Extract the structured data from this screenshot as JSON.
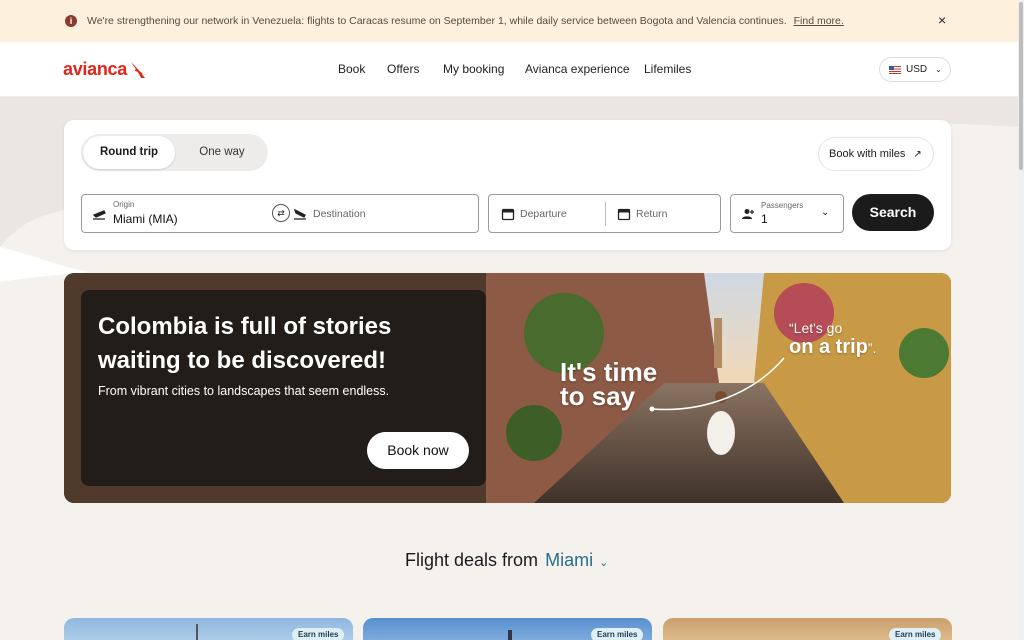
{
  "alert": {
    "message": "We're strengthening our network in Venezuela: flights to Caracas resume on September 1, while daily service between Bogota and Valencia continues.",
    "link_label": "Find more.",
    "close_label": "×"
  },
  "header": {
    "logo_text": "avianca",
    "nav": [
      "Book",
      "Offers",
      "My booking",
      "Avianca experience",
      "Lifemiles"
    ],
    "currency": "USD"
  },
  "search": {
    "trip_types": [
      "Round trip",
      "One way"
    ],
    "book_with_miles": "Book with miles",
    "origin_label": "Origin",
    "origin_value": "Miami (MIA)",
    "destination_placeholder": "Destination",
    "departure_placeholder": "Departure",
    "return_placeholder": "Return",
    "passengers_label": "Passengers",
    "passengers_value": "1",
    "search_button": "Search"
  },
  "hero": {
    "title": "Colombia is full of stories waiting to be discovered!",
    "subtitle": "From vibrant cities to landscapes that seem endless.",
    "cta": "Book now",
    "tagline_left_1": "It's time",
    "tagline_left_2": "to say",
    "tagline_right_1": "“Let's go",
    "tagline_right_2": "on a trip",
    "tagline_right_end": "”."
  },
  "deals": {
    "title_prefix": "Flight deals from",
    "city": "Miami",
    "badges": [
      "Earn miles",
      "Earn miles",
      "Earn miles"
    ]
  },
  "colors": {
    "brand_red": "#e1251b",
    "alert_bg": "#fdf0dd",
    "accent_blue": "#2a6c8f",
    "dark_button": "#1b1b1b"
  }
}
